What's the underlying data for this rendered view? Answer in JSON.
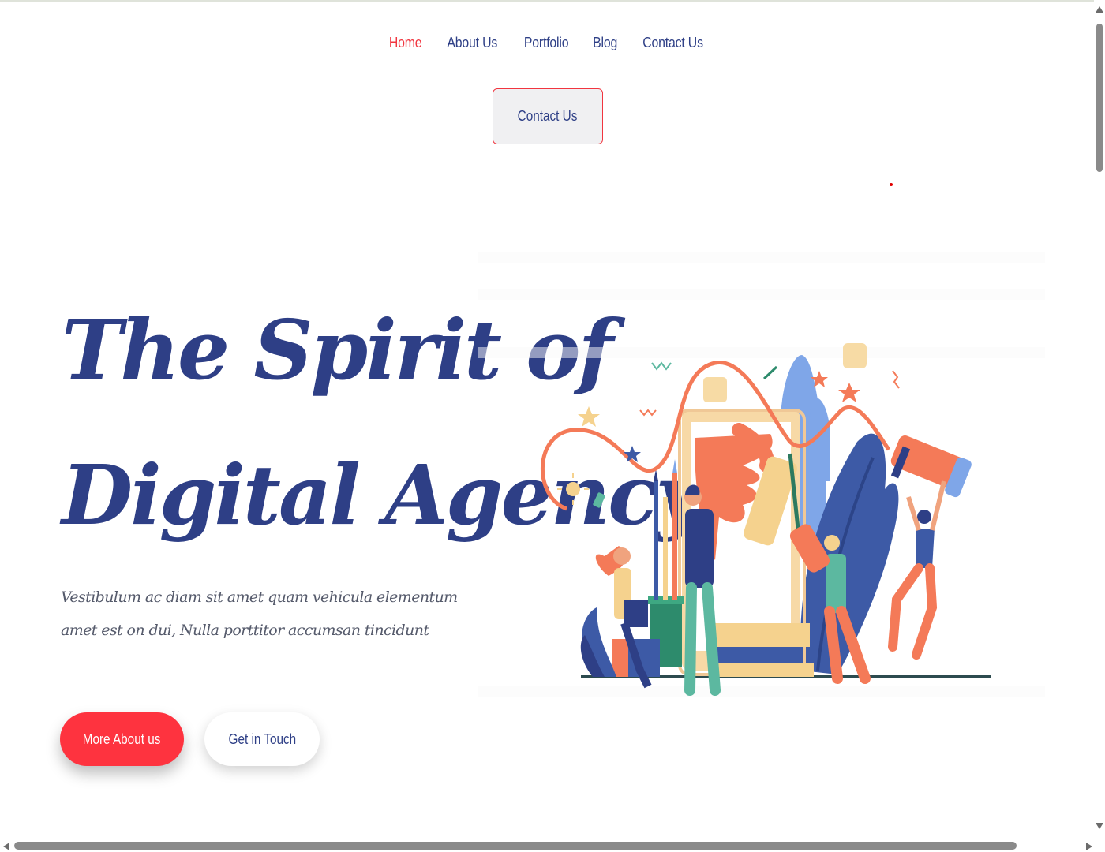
{
  "nav": {
    "items": [
      {
        "label": "Home",
        "active": true
      },
      {
        "label": "About Us",
        "active": false
      },
      {
        "label": "Portfolio",
        "active": false
      },
      {
        "label": "Blog",
        "active": false
      },
      {
        "label": "Contact Us",
        "active": false
      }
    ],
    "cta_label": "Contact Us"
  },
  "hero": {
    "title_line1": "The Spirit of",
    "title_line2": "Digital Agency",
    "subtitle_line1": "Vestibulum ac diam sit amet quam vehicula elementum",
    "subtitle_line2": "amet est on dui, Nulla porttitor accumsan tincidunt",
    "primary_button": "More About us",
    "secondary_button": "Get in Touch",
    "illustration_icon": "creative-team-illustration"
  },
  "colors": {
    "accent": "#fe333f",
    "navy": "#2e3f86",
    "text_muted": "#555a6b",
    "illustration_orange": "#f47a58",
    "illustration_blue": "#3d5aa6",
    "illustration_light_blue": "#7fa6e8",
    "illustration_cream": "#f5d28e",
    "illustration_green": "#5cb8a0"
  }
}
